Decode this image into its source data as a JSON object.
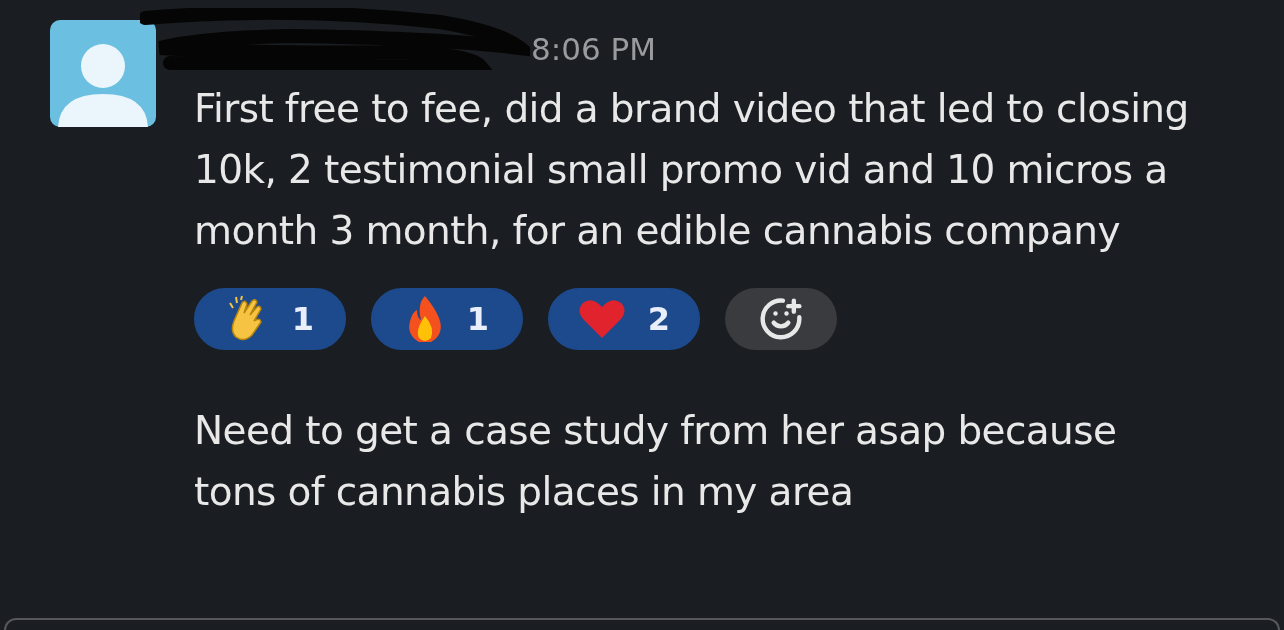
{
  "message": {
    "time": "8:06 PM",
    "text": "First free to fee, did a brand video that led to closing 10k, 2 testimonial small promo vid and 10 micros a month 3 month, for an edible cannabis company",
    "reactions": [
      {
        "kind": "clap",
        "count": "1",
        "selected": true
      },
      {
        "kind": "fire",
        "count": "1",
        "selected": true
      },
      {
        "kind": "heart",
        "count": "2",
        "selected": true
      }
    ]
  },
  "followup": {
    "text": "Need to get a case study from her asap because tons of cannabis places in my area"
  }
}
